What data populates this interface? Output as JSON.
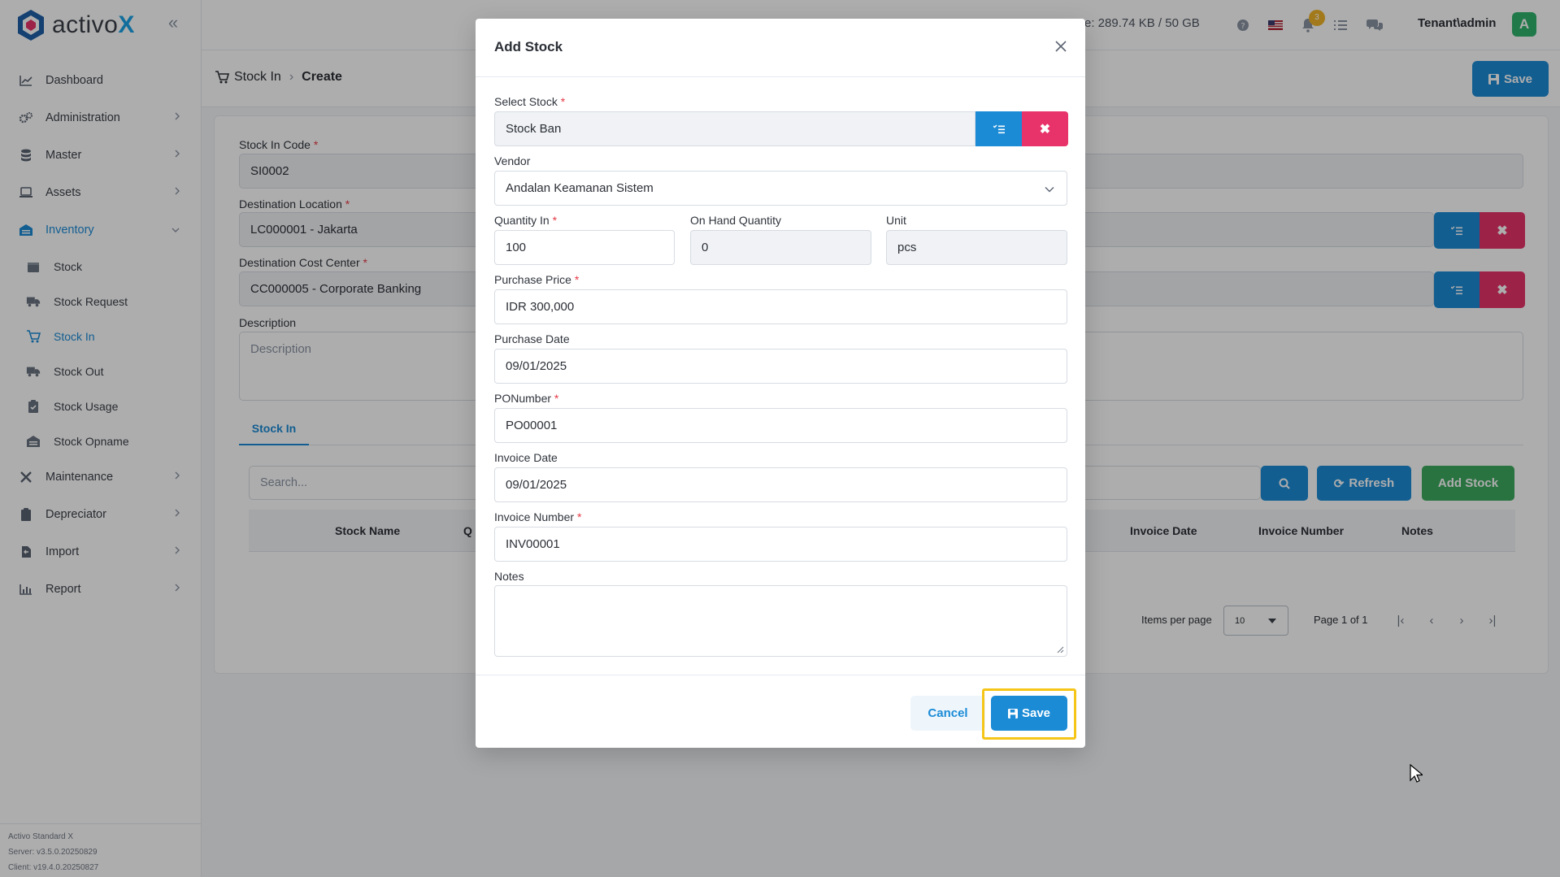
{
  "app": {
    "logo_text_a": "activo",
    "logo_text_b": "X",
    "storage": "e: 289.74 KB / 50 GB",
    "notifications_count": "3",
    "user": "Tenant\\admin",
    "avatar_letter": "A"
  },
  "sidebar": {
    "items": [
      {
        "label": "Dashboard",
        "icon": "chart-line-icon"
      },
      {
        "label": "Administration",
        "icon": "gears-icon"
      },
      {
        "label": "Master",
        "icon": "database-icon"
      },
      {
        "label": "Assets",
        "icon": "laptop-icon"
      },
      {
        "label": "Inventory",
        "icon": "warehouse-icon"
      }
    ],
    "inventory_sub": [
      {
        "label": "Stock",
        "icon": "box-icon"
      },
      {
        "label": "Stock Request",
        "icon": "truck-icon"
      },
      {
        "label": "Stock In",
        "icon": "cart-in-icon"
      },
      {
        "label": "Stock Out",
        "icon": "truck-out-icon"
      },
      {
        "label": "Stock Usage",
        "icon": "clipboard-icon"
      },
      {
        "label": "Stock Opname",
        "icon": "warehouse-icon"
      }
    ],
    "items_after": [
      {
        "label": "Maintenance",
        "icon": "tools-icon"
      },
      {
        "label": "Depreciator",
        "icon": "clipboard-icon"
      },
      {
        "label": "Import",
        "icon": "import-icon"
      },
      {
        "label": "Report",
        "icon": "chart-icon"
      }
    ],
    "footer": {
      "product": "Activo Standard X",
      "server": "Server: v3.5.0.20250829",
      "client": "Client: v19.4.0.20250827"
    }
  },
  "page": {
    "breadcrumb_parent": "Stock In",
    "breadcrumb_current": "Create",
    "save_label": "Save",
    "stock_in_code_label": "Stock In Code",
    "stock_in_code": "SI0002",
    "destination_location_label": "Destination Location",
    "destination_location": "LC000001 - Jakarta",
    "destination_cost_center_label": "Destination Cost Center",
    "destination_cost_center": "CC000005 - Corporate Banking",
    "description_label": "Description",
    "description_placeholder": "Description",
    "tab_label": "Stock In",
    "search_placeholder": "Search...",
    "refresh_label": "Refresh",
    "add_stock_label": "Add Stock",
    "columns": [
      "Stock Name",
      "Q",
      "Invoice Date",
      "Invoice Number",
      "Notes"
    ],
    "items_per_page_label": "Items per page",
    "items_per_page": "10",
    "page_info": "Page 1 of 1"
  },
  "modal": {
    "title": "Add Stock",
    "select_stock_label": "Select Stock",
    "select_stock_value": "Stock Ban",
    "vendor_label": "Vendor",
    "vendor_value": "Andalan Keamanan Sistem",
    "quantity_in_label": "Quantity In",
    "quantity_in_value": "100",
    "on_hand_label": "On Hand Quantity",
    "on_hand_value": "0",
    "unit_label": "Unit",
    "unit_value": "pcs",
    "purchase_price_label": "Purchase Price",
    "purchase_price_value": "IDR 300,000",
    "purchase_date_label": "Purchase Date",
    "purchase_date_value": "09/01/2025",
    "po_number_label": "PONumber",
    "po_number_value": "PO00001",
    "invoice_date_label": "Invoice Date",
    "invoice_date_value": "09/01/2025",
    "invoice_number_label": "Invoice Number",
    "invoice_number_value": "INV00001",
    "notes_label": "Notes",
    "notes_value": "",
    "cancel_label": "Cancel",
    "save_label": "Save"
  },
  "colors": {
    "accent": "#1b8bd6",
    "danger": "#e8336a",
    "success": "#3daa5f",
    "highlight": "#f5c518"
  }
}
